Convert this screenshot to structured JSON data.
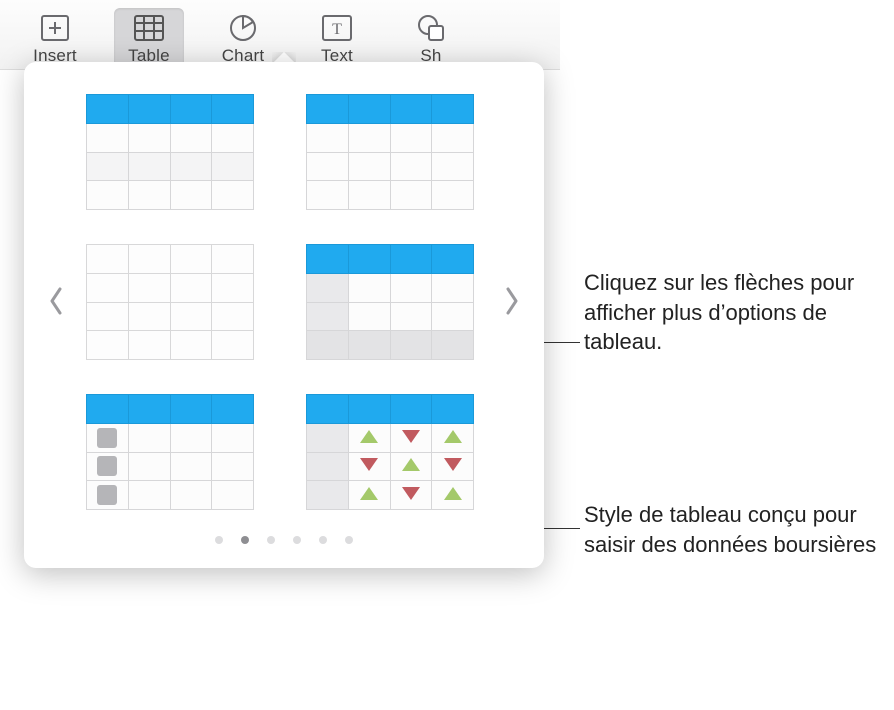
{
  "toolbar": {
    "items": [
      {
        "id": "insert",
        "label": "Insert",
        "icon": "insert-icon"
      },
      {
        "id": "table",
        "label": "Table",
        "icon": "table-icon",
        "active": true
      },
      {
        "id": "chart",
        "label": "Chart",
        "icon": "chart-icon"
      },
      {
        "id": "text",
        "label": "Text",
        "icon": "text-icon"
      },
      {
        "id": "shape",
        "label": "Sh",
        "icon": "shape-icon"
      }
    ]
  },
  "popover": {
    "nav": {
      "prev": "‹",
      "next": "›"
    },
    "page_count": 6,
    "current_page_index": 1,
    "thumbnails": [
      {
        "id": "table-style-1",
        "has_header_row": true,
        "has_header_col": false
      },
      {
        "id": "table-style-2",
        "has_header_row": true,
        "has_header_col": false
      },
      {
        "id": "table-style-3",
        "has_header_row": false,
        "has_header_col": false
      },
      {
        "id": "table-style-4",
        "has_header_row": true,
        "has_header_col": true,
        "has_footer": true
      },
      {
        "id": "table-style-5",
        "has_header_row": true,
        "first_col_squares": true
      },
      {
        "id": "table-style-6-stock",
        "has_header_row": true,
        "has_header_col": true,
        "stock_triangles": true
      }
    ]
  },
  "callouts": {
    "arrows": "Cliquez sur les flèches pour afficher plus d’options de tableau.",
    "stock": "Style de tableau conçu pour saisir des données boursières"
  },
  "colors": {
    "header_blue": "#20aaef"
  }
}
